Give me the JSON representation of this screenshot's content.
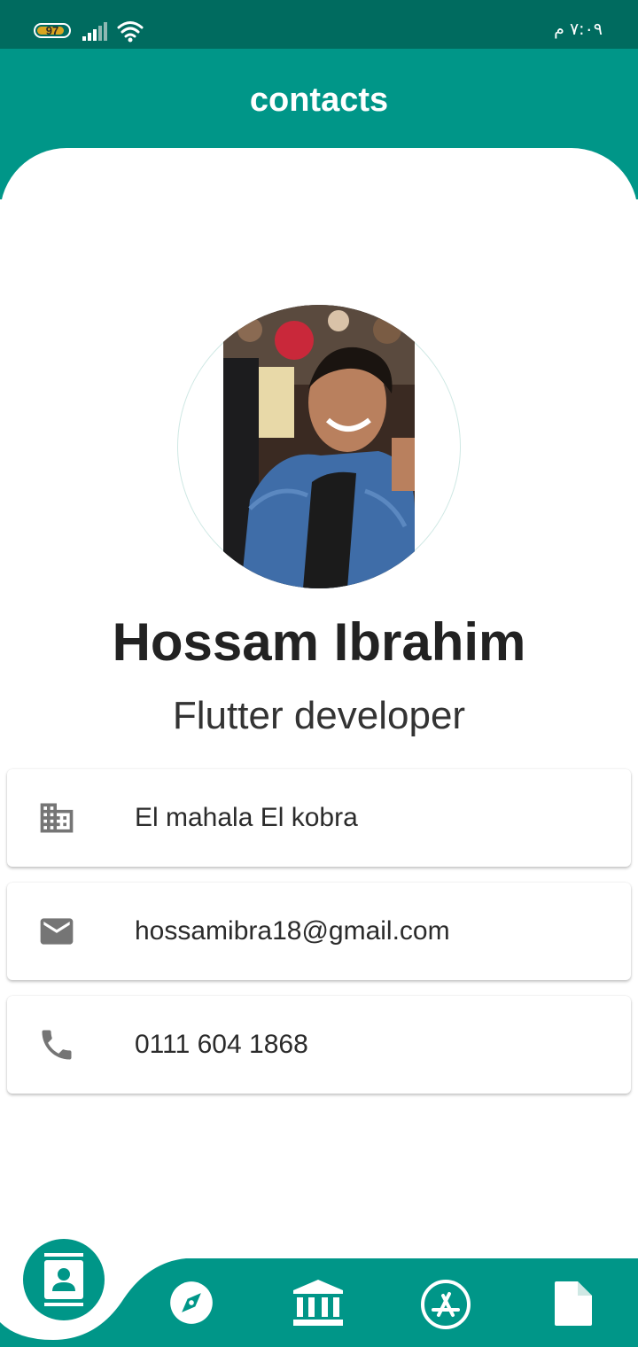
{
  "status_bar": {
    "battery_level": "97",
    "clock": "٧:٠٩ م",
    "battery_color": "#d9a520",
    "icons": [
      "battery-icon",
      "signal-icon",
      "wifi-icon"
    ]
  },
  "app_bar": {
    "title": "contacts"
  },
  "profile": {
    "name": "Hossam Ibrahim",
    "role": "Flutter developer"
  },
  "contact_cards": {
    "location": {
      "icon": "building-icon",
      "text": "El mahala El kobra"
    },
    "email": {
      "icon": "email-icon",
      "text": "hossamibra18@gmail.com"
    },
    "phone": {
      "icon": "phone-icon",
      "text": "0111 604 1868"
    }
  },
  "bottom_nav": {
    "active_index": 0,
    "items": [
      {
        "icon": "contacts-icon",
        "active": true
      },
      {
        "icon": "compass-icon",
        "active": false
      },
      {
        "icon": "bank-icon",
        "active": false
      },
      {
        "icon": "app-store-icon",
        "active": false
      },
      {
        "icon": "document-icon",
        "active": false
      }
    ]
  },
  "colors": {
    "primary": "#009688",
    "status_bar": "#006b5f",
    "nav_background": "#009688",
    "icon_gray": "#757575",
    "text_dark": "#222222"
  }
}
